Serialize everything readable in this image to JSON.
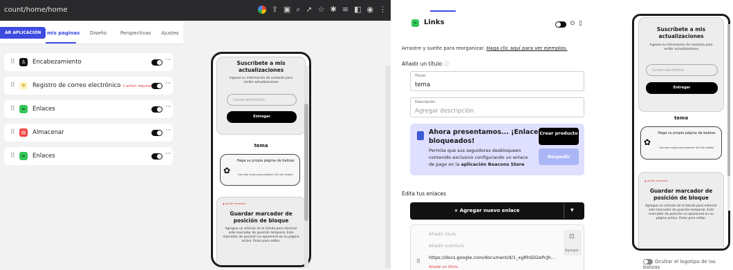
{
  "browser": {
    "url": "count/home/home",
    "tool_icons": [
      "google-icon",
      "share-icon",
      "screenshot-icon",
      "zoom-icon",
      "send-icon",
      "star-icon",
      "pin-icon",
      "queue-icon",
      "split-icon",
      "profile-icon",
      "menu-icon"
    ]
  },
  "appbar": {
    "app_button": "AR APLICACIÓN",
    "tabs": [
      "mis paginas",
      "Diseño",
      "Perspectivas",
      "Ajustes"
    ],
    "active_tab": 0
  },
  "blocks": [
    {
      "label": "Encabezamiento",
      "sub": "",
      "icon": "person-icon",
      "color": "#111111"
    },
    {
      "label": "Registro de correo electrónico",
      "sub": "1 action required",
      "icon": "signup-icon",
      "color": "#f2d24b"
    },
    {
      "label": "Enlaces",
      "sub": "",
      "icon": "link-icon",
      "color": "#34c759"
    },
    {
      "label": "Almacenar",
      "sub": "",
      "icon": "store-icon",
      "color": "#ef4444"
    },
    {
      "label": "Enlaces",
      "sub": "",
      "icon": "link-icon",
      "color": "#34c759"
    }
  ],
  "preview": {
    "subscribe_title": "Suscríbete a mis actualizaciones",
    "subscribe_sub": "Ingrese su información de contacto para recibir actualizaciones",
    "email_placeholder": "Correo electrónico",
    "submit": "Entregar",
    "section_title": "tema",
    "link_title": "Haga su propia página de balizas",
    "link_sub": "Use este enlace para obtener $20 de crédito!",
    "badge": "Acción necesaria",
    "store_title": "Guardar marcador de posición de bloque",
    "store_desc": "Agregue un artículo de la tienda para eliminar este marcador de posición temporal. Este marcador de posición no aparecerá en su página activa. Pulse para editar."
  },
  "editor": {
    "header": "Links",
    "hint_prefix": "Arrastre y suelte para reorganizar. ",
    "hint_link": "Haga clic aquí para ver ejemplos.",
    "add_title": "Añadir un título",
    "title_label": "Titular",
    "title_value": "tema",
    "desc_label": "Descripción",
    "desc_placeholder": "Agregar descripción",
    "promo_title": "Ahora presentamos... ¡Enlaces bloqueados!",
    "promo_desc_1": "Permita que sus seguidores desbloqueen contenido exclusivo configurando un enlace de pago en la ",
    "promo_desc_bold": "aplicación Beacons Store",
    "promo_btn_create": "Crear producto",
    "promo_btn_dismiss": "Despedir",
    "edit_links": "Edita tus enlaces",
    "add_link": "+ Agregar nuevo enlace",
    "link_card": {
      "title_ph": "Añadir título",
      "subtitle_ph": "Añadir subtítulo",
      "url": "https://docs.google.com/document/d/1_xgRhSD2ePcJh...",
      "add_title_link": "Añade un título",
      "image_btn": "Agregar"
    },
    "hide_logo": "Ocultar el logotipo de las balizas"
  }
}
